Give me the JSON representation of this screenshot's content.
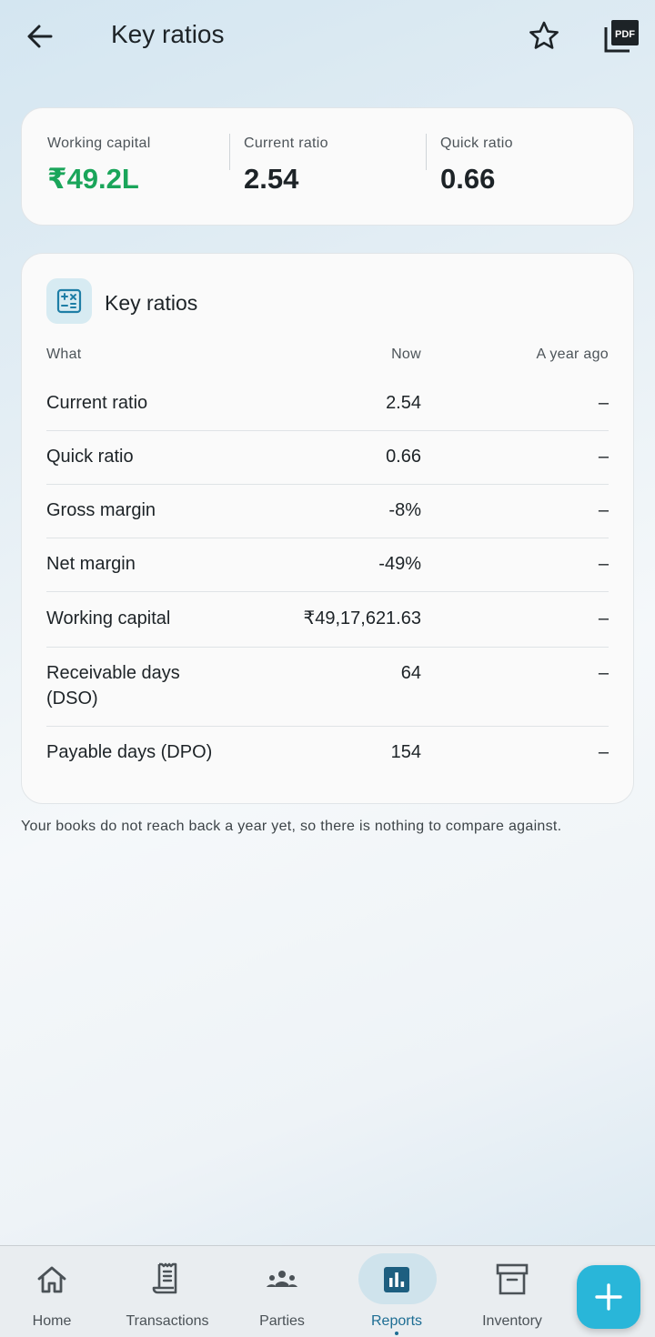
{
  "header": {
    "title": "Key ratios"
  },
  "summary": [
    {
      "label": "Working capital",
      "value": "₹49.2L"
    },
    {
      "label": "Current ratio",
      "value": "2.54"
    },
    {
      "label": "Quick ratio",
      "value": "0.66"
    }
  ],
  "card": {
    "title": "Key ratios",
    "columns": {
      "what": "What",
      "now": "Now",
      "ago": "A year ago"
    },
    "rows": [
      {
        "name": "Current ratio",
        "now": "2.54",
        "ago": "–"
      },
      {
        "name": "Quick ratio",
        "now": "0.66",
        "ago": "–"
      },
      {
        "name": "Gross margin",
        "now": "-8%",
        "ago": "–"
      },
      {
        "name": "Net margin",
        "now": "-49%",
        "ago": "–"
      },
      {
        "name": "Working capital",
        "now": "₹49,17,621.63",
        "ago": "–"
      },
      {
        "name": "Receivable days (DSO)",
        "now": "64",
        "ago": "–"
      },
      {
        "name": "Payable days (DPO)",
        "now": "154",
        "ago": "–"
      }
    ]
  },
  "footnote": "Your books do not reach back a year yet, so there is nothing to compare against.",
  "nav": {
    "items": [
      {
        "label": "Home",
        "icon": "home-icon"
      },
      {
        "label": "Transactions",
        "icon": "receipt-icon"
      },
      {
        "label": "Parties",
        "icon": "group-icon"
      },
      {
        "label": "Reports",
        "icon": "bar-chart-icon",
        "active": true
      },
      {
        "label": "Inventory",
        "icon": "archive-box-icon"
      }
    ],
    "fab_icon": "plus-icon"
  },
  "colors": {
    "accent": "#29b6d9",
    "positive": "#1aa55a",
    "active_nav": "#1d6d93"
  }
}
